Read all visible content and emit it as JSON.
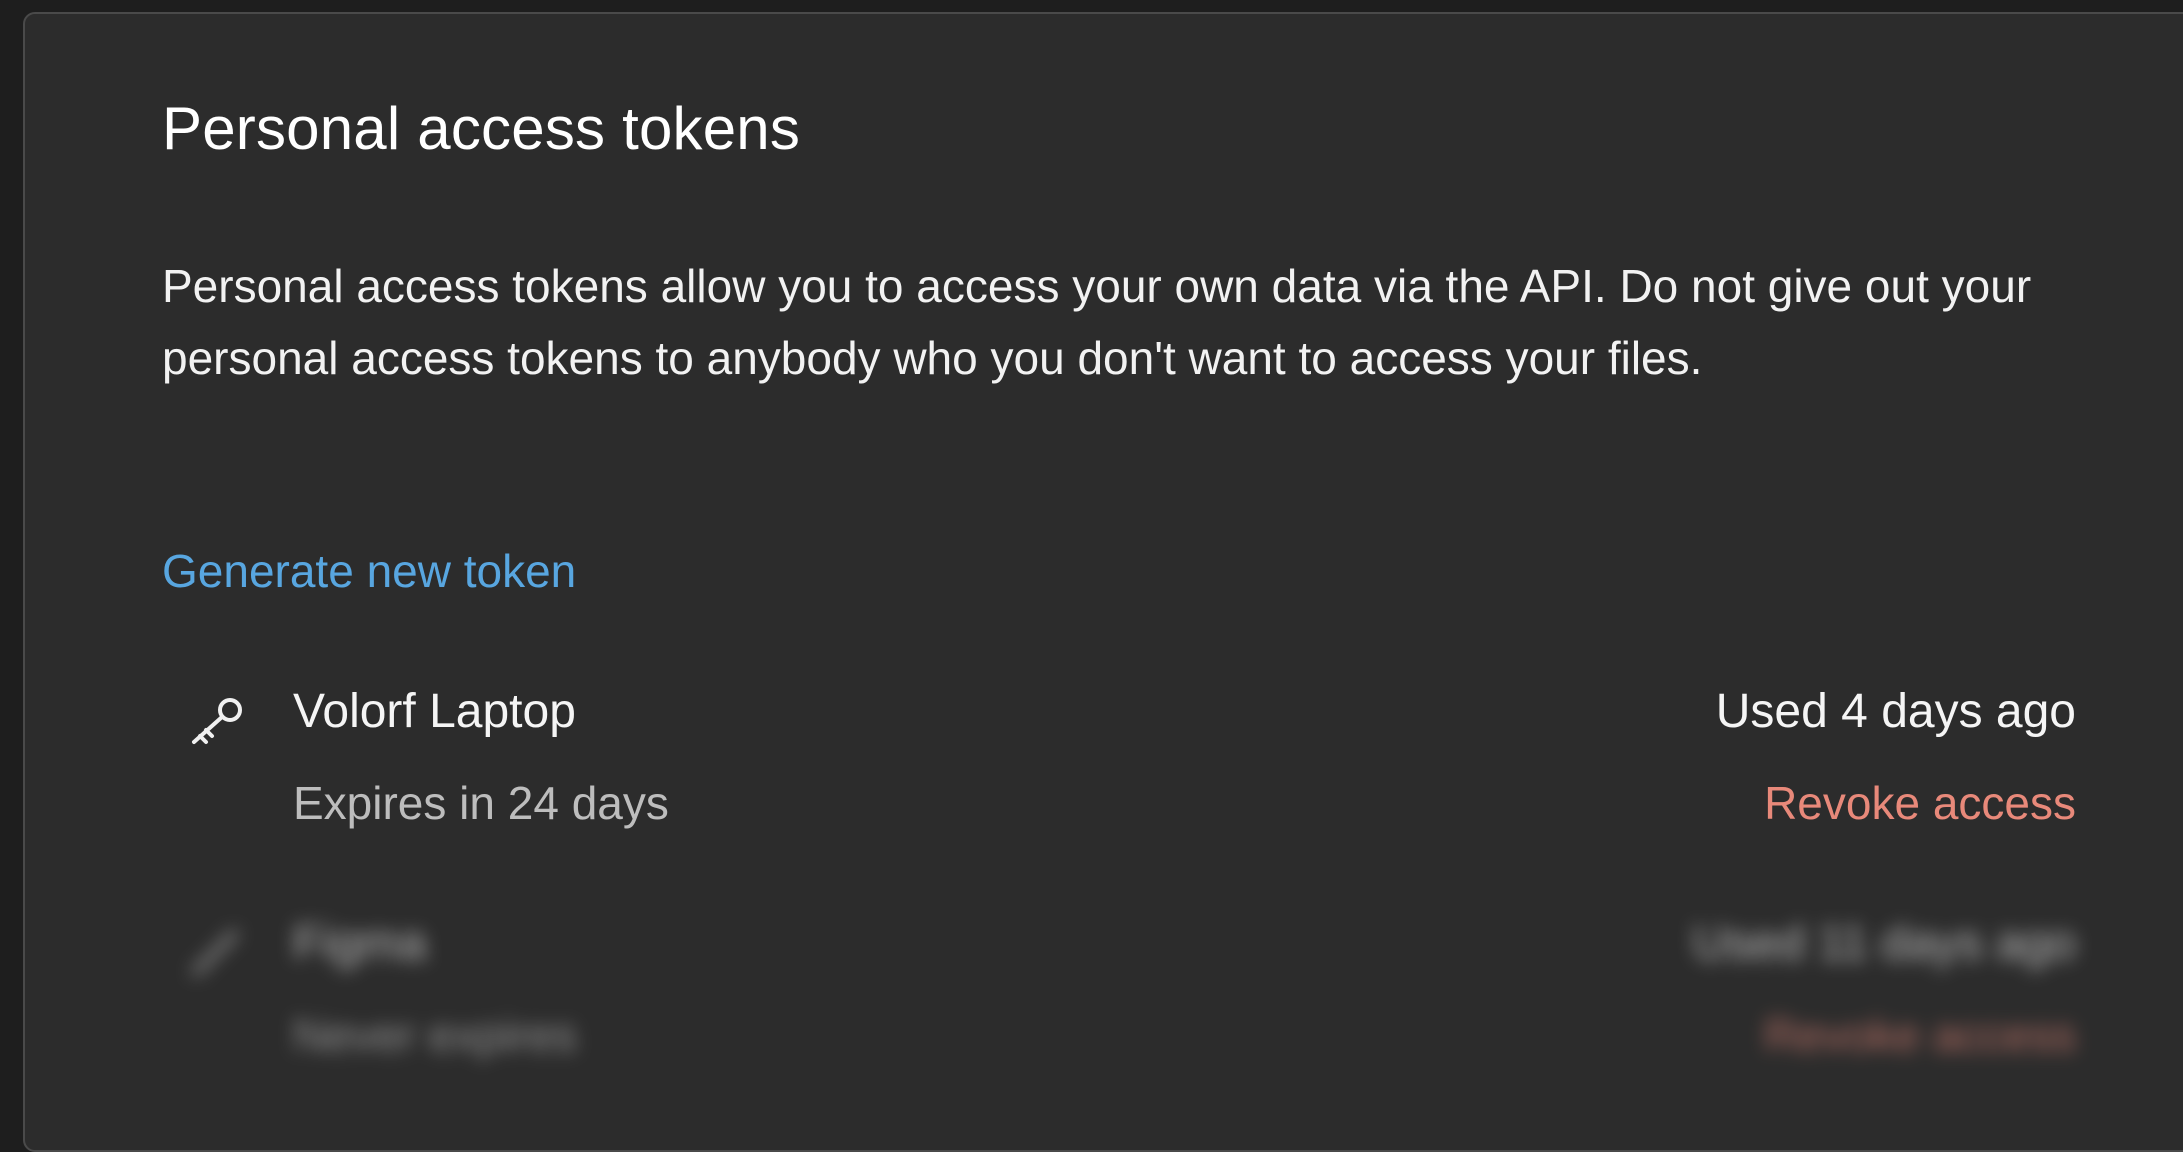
{
  "section": {
    "title": "Personal access tokens",
    "description": "Personal access tokens allow you to access your own data via the API. Do not give out your personal access tokens to anybody who you don't want to access your files.",
    "generate_link": "Generate new token"
  },
  "tokens": [
    {
      "icon": "key-icon",
      "name": "Volorf Laptop",
      "expiry": "Expires in 24 days",
      "last_used": "Used 4 days ago",
      "revoke_label": "Revoke access"
    },
    {
      "icon": "pen-icon",
      "name": "Figma",
      "expiry": "Never expires",
      "last_used": "Used 11 days ago",
      "revoke_label": "Revoke access"
    }
  ],
  "colors": {
    "panel_bg": "#2c2c2c",
    "link": "#58a6e0",
    "revoke": "#e8897a"
  }
}
